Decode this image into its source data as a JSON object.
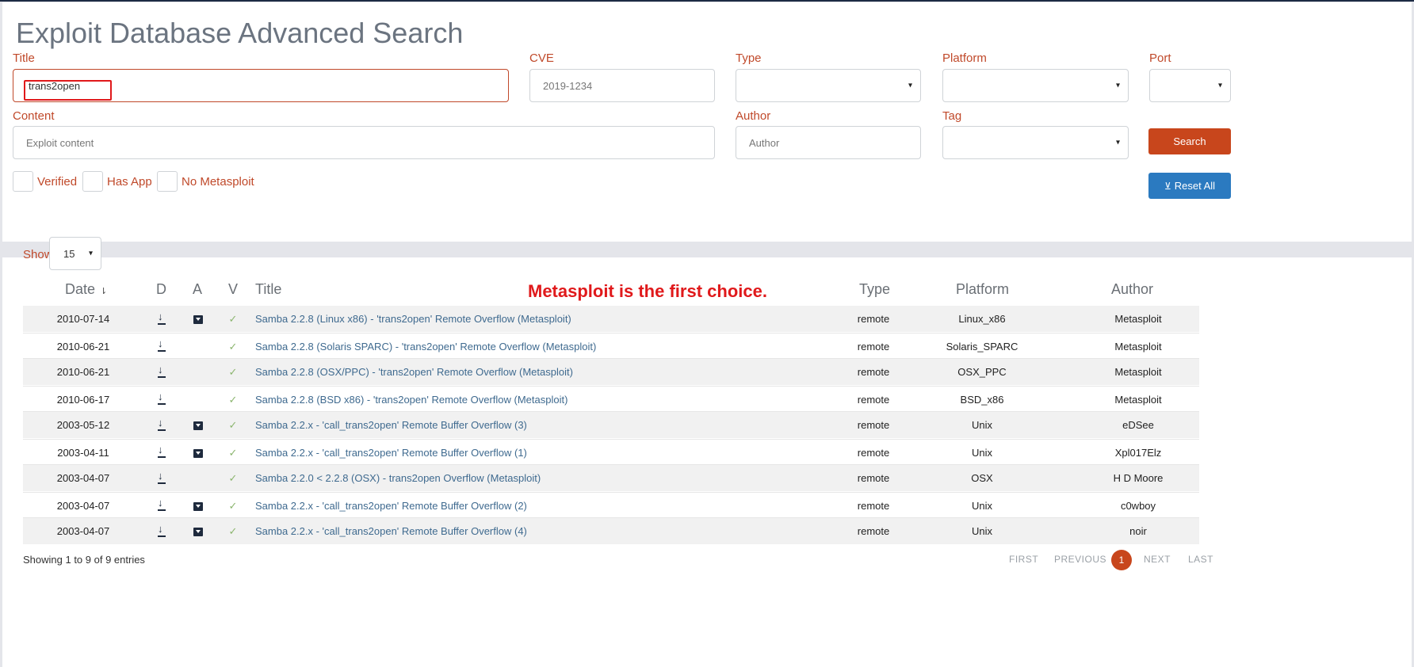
{
  "page": {
    "title": "Exploit Database Advanced Search"
  },
  "form": {
    "title_label": "Title",
    "title_value": "trans2open",
    "cve_label": "CVE",
    "cve_placeholder": "2019-1234",
    "type_label": "Type",
    "platform_label": "Platform",
    "port_label": "Port",
    "content_label": "Content",
    "content_placeholder": "Exploit content",
    "author_label": "Author",
    "author_placeholder": "Author",
    "tag_label": "Tag",
    "checkboxes": {
      "verified": "Verified",
      "has_app": "Has App",
      "no_metasploit": "No Metasploit"
    },
    "search_button": "Search",
    "reset_button": "Reset All",
    "select_caret": "▾"
  },
  "annotation": "Metasploit is the first choice.",
  "results": {
    "show_label": "Show",
    "show_value": "15",
    "columns": {
      "date": "Date",
      "d": "D",
      "a": "A",
      "v": "V",
      "title": "Title",
      "type": "Type",
      "platform": "Platform",
      "author": "Author"
    },
    "rows": [
      {
        "date": "2010-07-14",
        "app": true,
        "verified": true,
        "title": "Samba 2.2.8 (Linux x86) - 'trans2open' Remote Overflow (Metasploit)",
        "type": "remote",
        "platform": "Linux_x86",
        "author": "Metasploit"
      },
      {
        "date": "2010-06-21",
        "app": false,
        "verified": true,
        "title": "Samba 2.2.8 (Solaris SPARC) - 'trans2open' Remote Overflow (Metasploit)",
        "type": "remote",
        "platform": "Solaris_SPARC",
        "author": "Metasploit"
      },
      {
        "date": "2010-06-21",
        "app": false,
        "verified": true,
        "title": "Samba 2.2.8 (OSX/PPC) - 'trans2open' Remote Overflow (Metasploit)",
        "type": "remote",
        "platform": "OSX_PPC",
        "author": "Metasploit"
      },
      {
        "date": "2010-06-17",
        "app": false,
        "verified": true,
        "title": "Samba 2.2.8 (BSD x86) - 'trans2open' Remote Overflow (Metasploit)",
        "type": "remote",
        "platform": "BSD_x86",
        "author": "Metasploit"
      },
      {
        "date": "2003-05-12",
        "app": true,
        "verified": true,
        "title": "Samba 2.2.x - 'call_trans2open' Remote Buffer Overflow (3)",
        "type": "remote",
        "platform": "Unix",
        "author": "eDSee"
      },
      {
        "date": "2003-04-11",
        "app": true,
        "verified": true,
        "title": "Samba 2.2.x - 'call_trans2open' Remote Buffer Overflow (1)",
        "type": "remote",
        "platform": "Unix",
        "author": "Xpl017Elz"
      },
      {
        "date": "2003-04-07",
        "app": false,
        "verified": true,
        "title": "Samba 2.2.0 < 2.2.8 (OSX) - trans2open Overflow (Metasploit)",
        "type": "remote",
        "platform": "OSX",
        "author": "H D Moore"
      },
      {
        "date": "2003-04-07",
        "app": true,
        "verified": true,
        "title": "Samba 2.2.x - 'call_trans2open' Remote Buffer Overflow (2)",
        "type": "remote",
        "platform": "Unix",
        "author": "c0wboy"
      },
      {
        "date": "2003-04-07",
        "app": true,
        "verified": true,
        "title": "Samba 2.2.x - 'call_trans2open' Remote Buffer Overflow (4)",
        "type": "remote",
        "platform": "Unix",
        "author": "noir"
      }
    ],
    "info": "Showing 1 to 9 of 9 entries",
    "pagination": {
      "first": "FIRST",
      "previous": "PREVIOUS",
      "current": "1",
      "next": "NEXT",
      "last": "LAST"
    }
  },
  "colors": {
    "accent": "#c8461c",
    "reset": "#2b7ac0",
    "label": "#c0492a",
    "link": "#3f6a8f",
    "annotation": "#e0191b"
  }
}
